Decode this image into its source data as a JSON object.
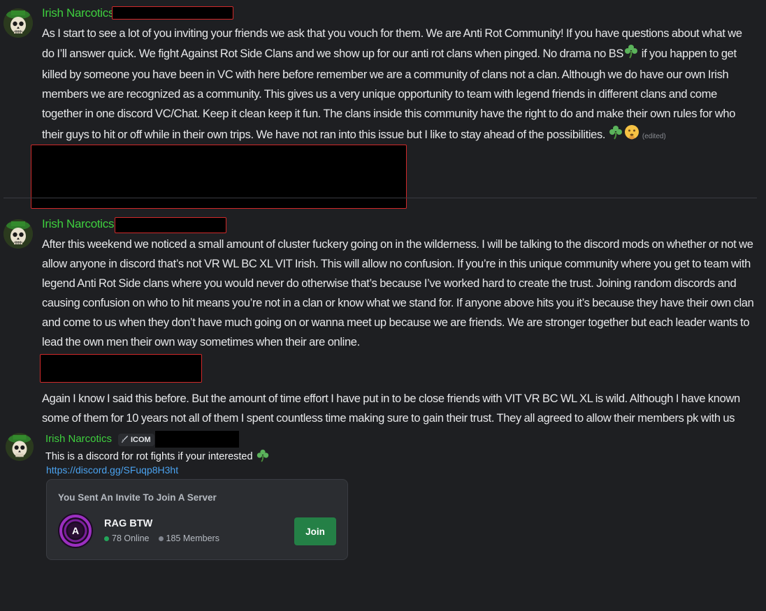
{
  "messages": [
    {
      "username": "Irish Narcotics",
      "text": "As I start to see a lot of you inviting your friends we ask that you vouch for them. We are Anti Rot Community! If you have questions about what we do I’ll answer quick. We fight Against Rot Side Clans and we show up for our anti rot clans when pinged. No drama no BS",
      "text_b": " if you happen to get killed by someone you have been in VC with here before remember we are a community of clans not a clan. Although we do have our own Irish members we are recognized as a community. This gives us a very unique opportunity to team with legend friends in different clans and come together in one discord VC/Chat. Keep it clean keep it fun. The clans inside this community have the right to do and make their own rules for who their guys to hit or off while in their own trips. We have not ran into this issue but I like to stay ahead of the possibilities. ",
      "edited": "(edited)"
    },
    {
      "username": "Irish Narcotics",
      "text": "After this weekend we noticed a small amount of cluster fuckery going on in the wilderness. I will be talking to the discord mods on whether or not we allow anyone in discord that’s not VR WL BC XL VIT Irish. This will allow no confusion. If you’re in this unique community where you get to team with legend Anti Rot Side clans where you would never do otherwise that’s because I’ve worked hard to create the trust. Joining random discords and causing confusion on who to hit means you’re not in a clan or know what we stand for. If anyone above hits you it’s because they have their own clan and come to us when they don’t have much going on or wanna meet up because we are friends. We are stronger together but each leader wants to lead the own men their own way sometimes when their are online.",
      "text2": "Again I know I said this before. But the amount of time effort I have put in to be close friends with VIT VR BC WL XL is wild. Although I have known some of them for 10 years not all of them I spent countless time making sure to gain their trust. They all agreed to allow their members pk with us"
    },
    {
      "username": "Irish Narcotics",
      "role_tag": "ICOM",
      "text": "This is a discord for rot fights if your interested",
      "link": "https://discord.gg/SFuqp8H3ht",
      "invite": {
        "header": "You Sent An Invite To Join A Server",
        "server_name": "RAG BTW",
        "server_initial": "A",
        "online": "78 Online",
        "members": "185 Members",
        "join_label": "Join"
      }
    }
  ],
  "colors": {
    "username": "#3ecf3e",
    "link": "#4ba3f0",
    "join": "#248046",
    "redaction_border": "#d0292a"
  },
  "icons": [
    "shamrock-emoji",
    "thinking-face-emoji",
    "sword-icon"
  ]
}
